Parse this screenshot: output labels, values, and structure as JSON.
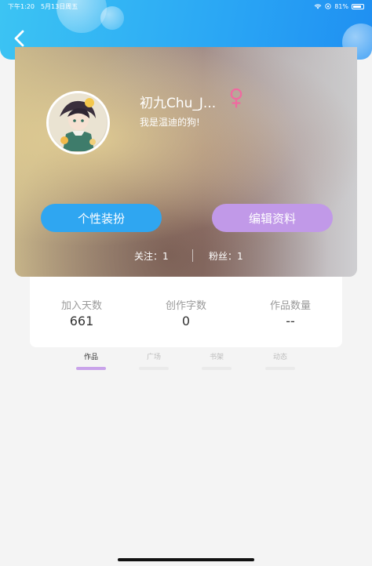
{
  "status_bar": {
    "time": "下午1:20",
    "date": "5月13日周五",
    "battery": "81%"
  },
  "profile": {
    "name": "初九Chu_J...",
    "bio": "我是温迪的狗!",
    "gender_icon": "female-icon",
    "dress_button": "个性装扮",
    "edit_button": "编辑资料",
    "following_label": "关注：",
    "following_count": "1",
    "followers_label": "粉丝：",
    "followers_count": "1"
  },
  "stats": [
    {
      "label": "加入天数",
      "value": "661"
    },
    {
      "label": "创作字数",
      "value": "0"
    },
    {
      "label": "作品数量",
      "value": "--"
    }
  ],
  "tabs": [
    {
      "label": "作品",
      "active": true
    },
    {
      "label": "广场",
      "active": false
    },
    {
      "label": "书架",
      "active": false
    },
    {
      "label": "动态",
      "active": false
    }
  ],
  "colors": {
    "header_blue": "#2aa6f4",
    "dress_button": "#2fa6f1",
    "edit_button": "#c199e8",
    "gender_pink": "#f06aa0",
    "tab_active_underline": "#c9a3ea"
  }
}
